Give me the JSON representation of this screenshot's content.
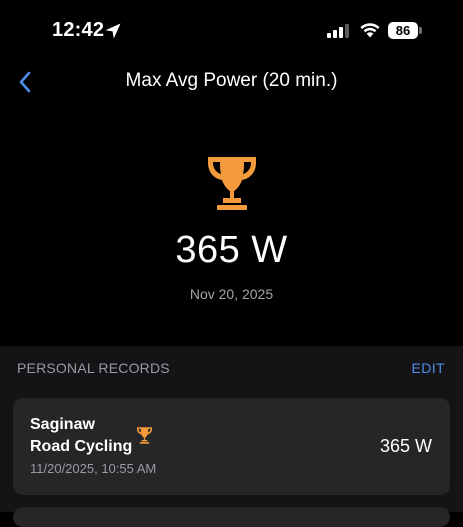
{
  "status_bar": {
    "time": "12:42",
    "battery": "86",
    "icons": [
      "location-arrow-icon",
      "cellular-signal-icon",
      "wifi-icon",
      "battery-icon"
    ]
  },
  "nav": {
    "back_icon": "chevron-left-icon",
    "title": "Max Avg Power (20 min.)"
  },
  "hero": {
    "icon": "trophy-icon",
    "value": "365 W",
    "date": "Nov 20, 2025"
  },
  "records": {
    "header": "PERSONAL RECORDS",
    "edit_label": "EDIT",
    "items": [
      {
        "name_line1": "Saginaw",
        "name_line2": "Road Cycling",
        "datetime": "11/20/2025, 10:55 AM",
        "value": "365 W",
        "icon": "trophy-icon"
      }
    ]
  },
  "colors": {
    "background": "#000000",
    "section_background": "#141416",
    "card_background": "#262628",
    "accent_orange": "#f39a3c",
    "link_blue": "#4d8ee8",
    "secondary_text": "#9a9aa0"
  }
}
